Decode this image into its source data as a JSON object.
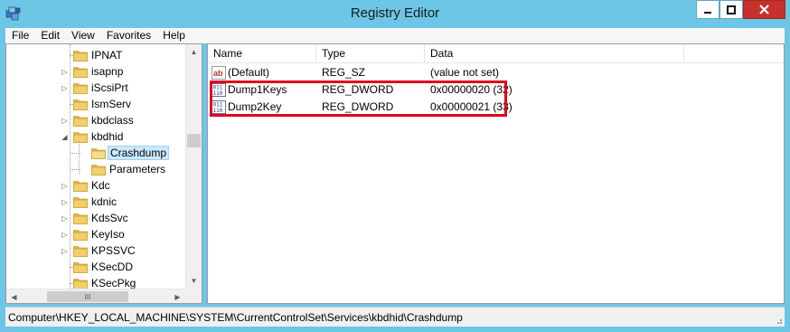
{
  "window": {
    "title": "Registry Editor"
  },
  "menu": [
    "File",
    "Edit",
    "View",
    "Favorites",
    "Help"
  ],
  "tree": {
    "items": [
      {
        "label": "IPNAT",
        "expandable": false,
        "selected": false
      },
      {
        "label": "isapnp",
        "expandable": true,
        "selected": false
      },
      {
        "label": "iScsiPrt",
        "expandable": true,
        "selected": false
      },
      {
        "label": "IsmServ",
        "expandable": false,
        "selected": false
      },
      {
        "label": "kbdclass",
        "expandable": true,
        "selected": false
      },
      {
        "label": "kbdhid",
        "expandable": true,
        "expanded": true,
        "selected": false
      },
      {
        "label": "Crashdump",
        "expandable": false,
        "selected": true,
        "child": true
      },
      {
        "label": "Parameters",
        "expandable": false,
        "selected": false,
        "child": true
      },
      {
        "label": "Kdc",
        "expandable": true,
        "selected": false
      },
      {
        "label": "kdnic",
        "expandable": true,
        "selected": false
      },
      {
        "label": "KdsSvc",
        "expandable": true,
        "selected": false
      },
      {
        "label": "KeyIso",
        "expandable": true,
        "selected": false
      },
      {
        "label": "KPSSVC",
        "expandable": true,
        "selected": false
      },
      {
        "label": "KSecDD",
        "expandable": false,
        "selected": false
      },
      {
        "label": "KSecPkg",
        "expandable": false,
        "selected": false
      }
    ],
    "hscroll_thumb_glyph": "III"
  },
  "values": {
    "columns": [
      "Name",
      "Type",
      "Data"
    ],
    "rows": [
      {
        "icon": "string-value-icon",
        "name": "(Default)",
        "type": "REG_SZ",
        "data": "(value not set)"
      },
      {
        "icon": "binary-value-icon",
        "name": "Dump1Keys",
        "type": "REG_DWORD",
        "data": "0x00000020 (32)"
      },
      {
        "icon": "binary-value-icon",
        "name": "Dump2Key",
        "type": "REG_DWORD",
        "data": "0x00000021 (33)"
      }
    ]
  },
  "status": {
    "path": "Computer\\HKEY_LOCAL_MACHINE\\SYSTEM\\CurrentControlSet\\Services\\kbdhid\\Crashdump"
  },
  "colors": {
    "titlebar": "#6dc6e6",
    "highlight": "#e0001b",
    "selection": "#cce8ff",
    "close": "#c7312b"
  }
}
